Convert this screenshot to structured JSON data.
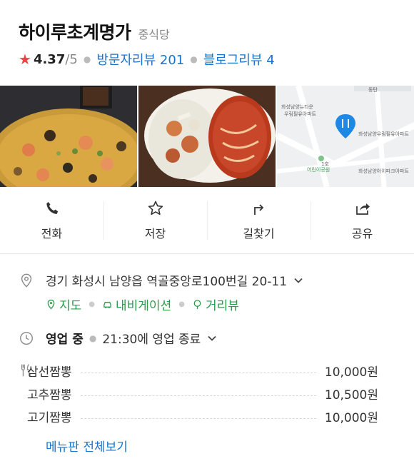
{
  "place": {
    "name": "하이루초계명가",
    "category": "중식당",
    "rating_star": "★",
    "rating": "4.37",
    "rating_max": "/5",
    "visitor_reviews": "방문자리뷰 201",
    "blog_reviews": "블로그리뷰 4"
  },
  "photos": {
    "map_labels": [
      "동탄",
      "화성남양뉴타운",
      "우림필유아파트",
      "화성남양우림필유아파트",
      "어린이공원",
      "화성남양아이파크아파트",
      "1호"
    ]
  },
  "actions": [
    {
      "label": "전화",
      "icon": "phone-icon"
    },
    {
      "label": "저장",
      "icon": "star-outline-icon"
    },
    {
      "label": "길찾기",
      "icon": "directions-icon"
    },
    {
      "label": "공유",
      "icon": "share-icon"
    }
  ],
  "address": {
    "text": "경기 화성시 남양읍 역골중앙로100번길 20-11",
    "links": [
      {
        "label": "지도",
        "icon": "map-pin-icon"
      },
      {
        "label": "내비게이션",
        "icon": "car-icon"
      },
      {
        "label": "거리뷰",
        "icon": "street-view-icon"
      }
    ]
  },
  "hours": {
    "status": "영업 중",
    "detail": "21:30에 영업 종료"
  },
  "menu": {
    "items": [
      {
        "name": "삼선짬뽕",
        "price": "10,000원"
      },
      {
        "name": "고추짬뽕",
        "price": "10,500원"
      },
      {
        "name": "고기짬뽕",
        "price": "10,000원"
      }
    ],
    "view_all": "메뉴판 전체보기"
  },
  "colors": {
    "accent_blue": "#1a73c9",
    "accent_green": "#2c9b4a",
    "star_red": "#e84545"
  }
}
